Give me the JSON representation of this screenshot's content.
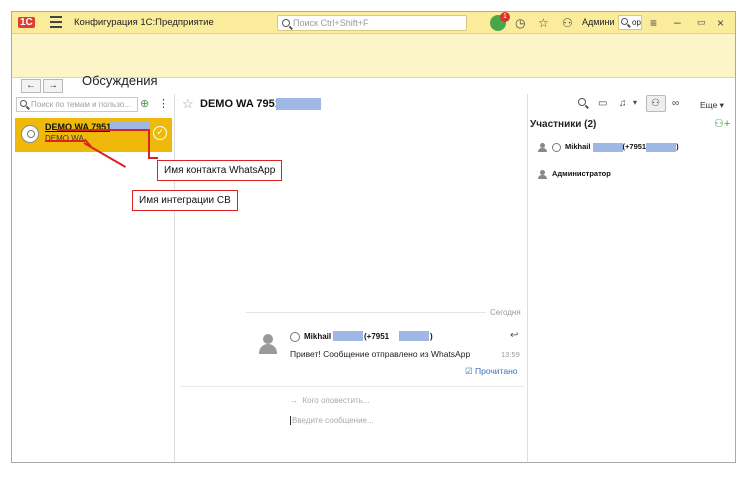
{
  "topbar": {
    "logo": "1С",
    "title": "Конфигурация 1С:Предприятие",
    "search_placeholder": "Поиск Ctrl+Shift+F",
    "notification_count": "1",
    "user_name": "Админи",
    "user_search_label": "ор"
  },
  "header": {
    "back_label": "←",
    "forward_label": "→",
    "page_title": "Обсуждения"
  },
  "left": {
    "search_placeholder": "Поиск по темам и пользо...",
    "conversation": {
      "name": "DEMO WA 7951",
      "subtitle": "DEMO WA"
    }
  },
  "callouts": {
    "contact": "Имя контакта WhatsApp",
    "integration": "Имя интеграции CB"
  },
  "chat": {
    "title": "DEMO WA 7951",
    "date_separator": "Сегодня",
    "message": {
      "author": "Mikhail",
      "phone_prefix": "(+7951",
      "phone_suffix": ")",
      "text": "Привет! Сообщение отправлено из WhatsApp",
      "time": "13:59",
      "read_status": "Прочитано"
    },
    "notify_placeholder": "Кого оповестить...",
    "compose_placeholder": "Введите сообщение..."
  },
  "toolbar": {
    "more_label": "Еще"
  },
  "participants": {
    "title": "Участники (2)",
    "items": [
      {
        "name": "Mikhail",
        "phone_prefix": "(+7951",
        "phone_suffix": ")"
      },
      {
        "name": "Администратор"
      }
    ]
  }
}
